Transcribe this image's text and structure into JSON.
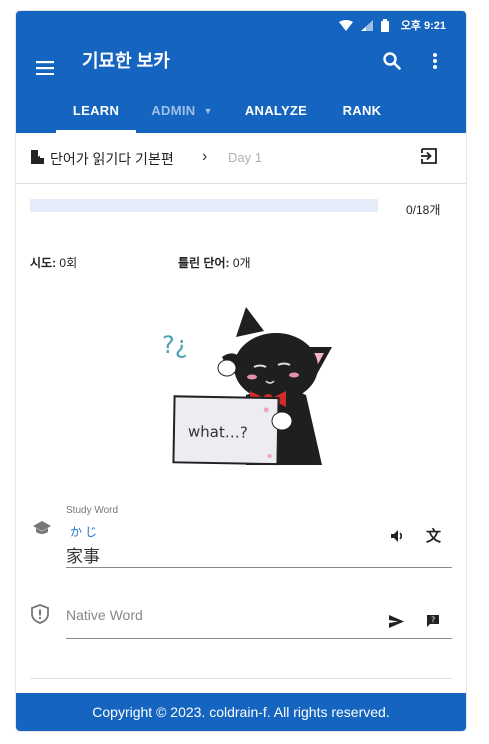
{
  "status_bar": {
    "time": "오후 9:21"
  },
  "app_bar": {
    "title": "기묘한 보카"
  },
  "tabs": [
    {
      "label": "LEARN",
      "active": true
    },
    {
      "label": "ADMIN",
      "active": false,
      "has_dropdown": true
    },
    {
      "label": "ANALYZE",
      "active": false
    },
    {
      "label": "RANK",
      "active": false
    }
  ],
  "breadcrumb": {
    "book": "단어가 읽기다 기본편",
    "day": "Day 1"
  },
  "progress": {
    "done": 0,
    "total": 18,
    "text": "0/18개"
  },
  "stats": {
    "attempts_label": "시도:",
    "attempts_value": "0회",
    "wrong_label": "틀린 단어:",
    "wrong_value": "0개"
  },
  "illustration": {
    "sign_text": "what…?",
    "mark": "?¿"
  },
  "study_word": {
    "label": "Study Word",
    "furigana": "かじ",
    "word": "家事"
  },
  "native_word": {
    "placeholder": "Native Word"
  },
  "icons": {
    "menu": "menu-icon",
    "search": "search-icon",
    "more": "more-vert-icon",
    "book": "book-icon",
    "exit": "exit-icon",
    "school": "school-icon",
    "volume": "volume-icon",
    "translate": "furigana-icon",
    "shield": "shield-alert-icon",
    "send": "send-icon",
    "hint": "hint-icon"
  },
  "colors": {
    "primary": "#1565c0",
    "tab_inactive": "#9fc0ea",
    "furigana": "#1976d2",
    "progress_track": "#e3ecf8"
  },
  "footer": {
    "text": "Copyright © 2023. coldrain-f. All rights reserved."
  }
}
